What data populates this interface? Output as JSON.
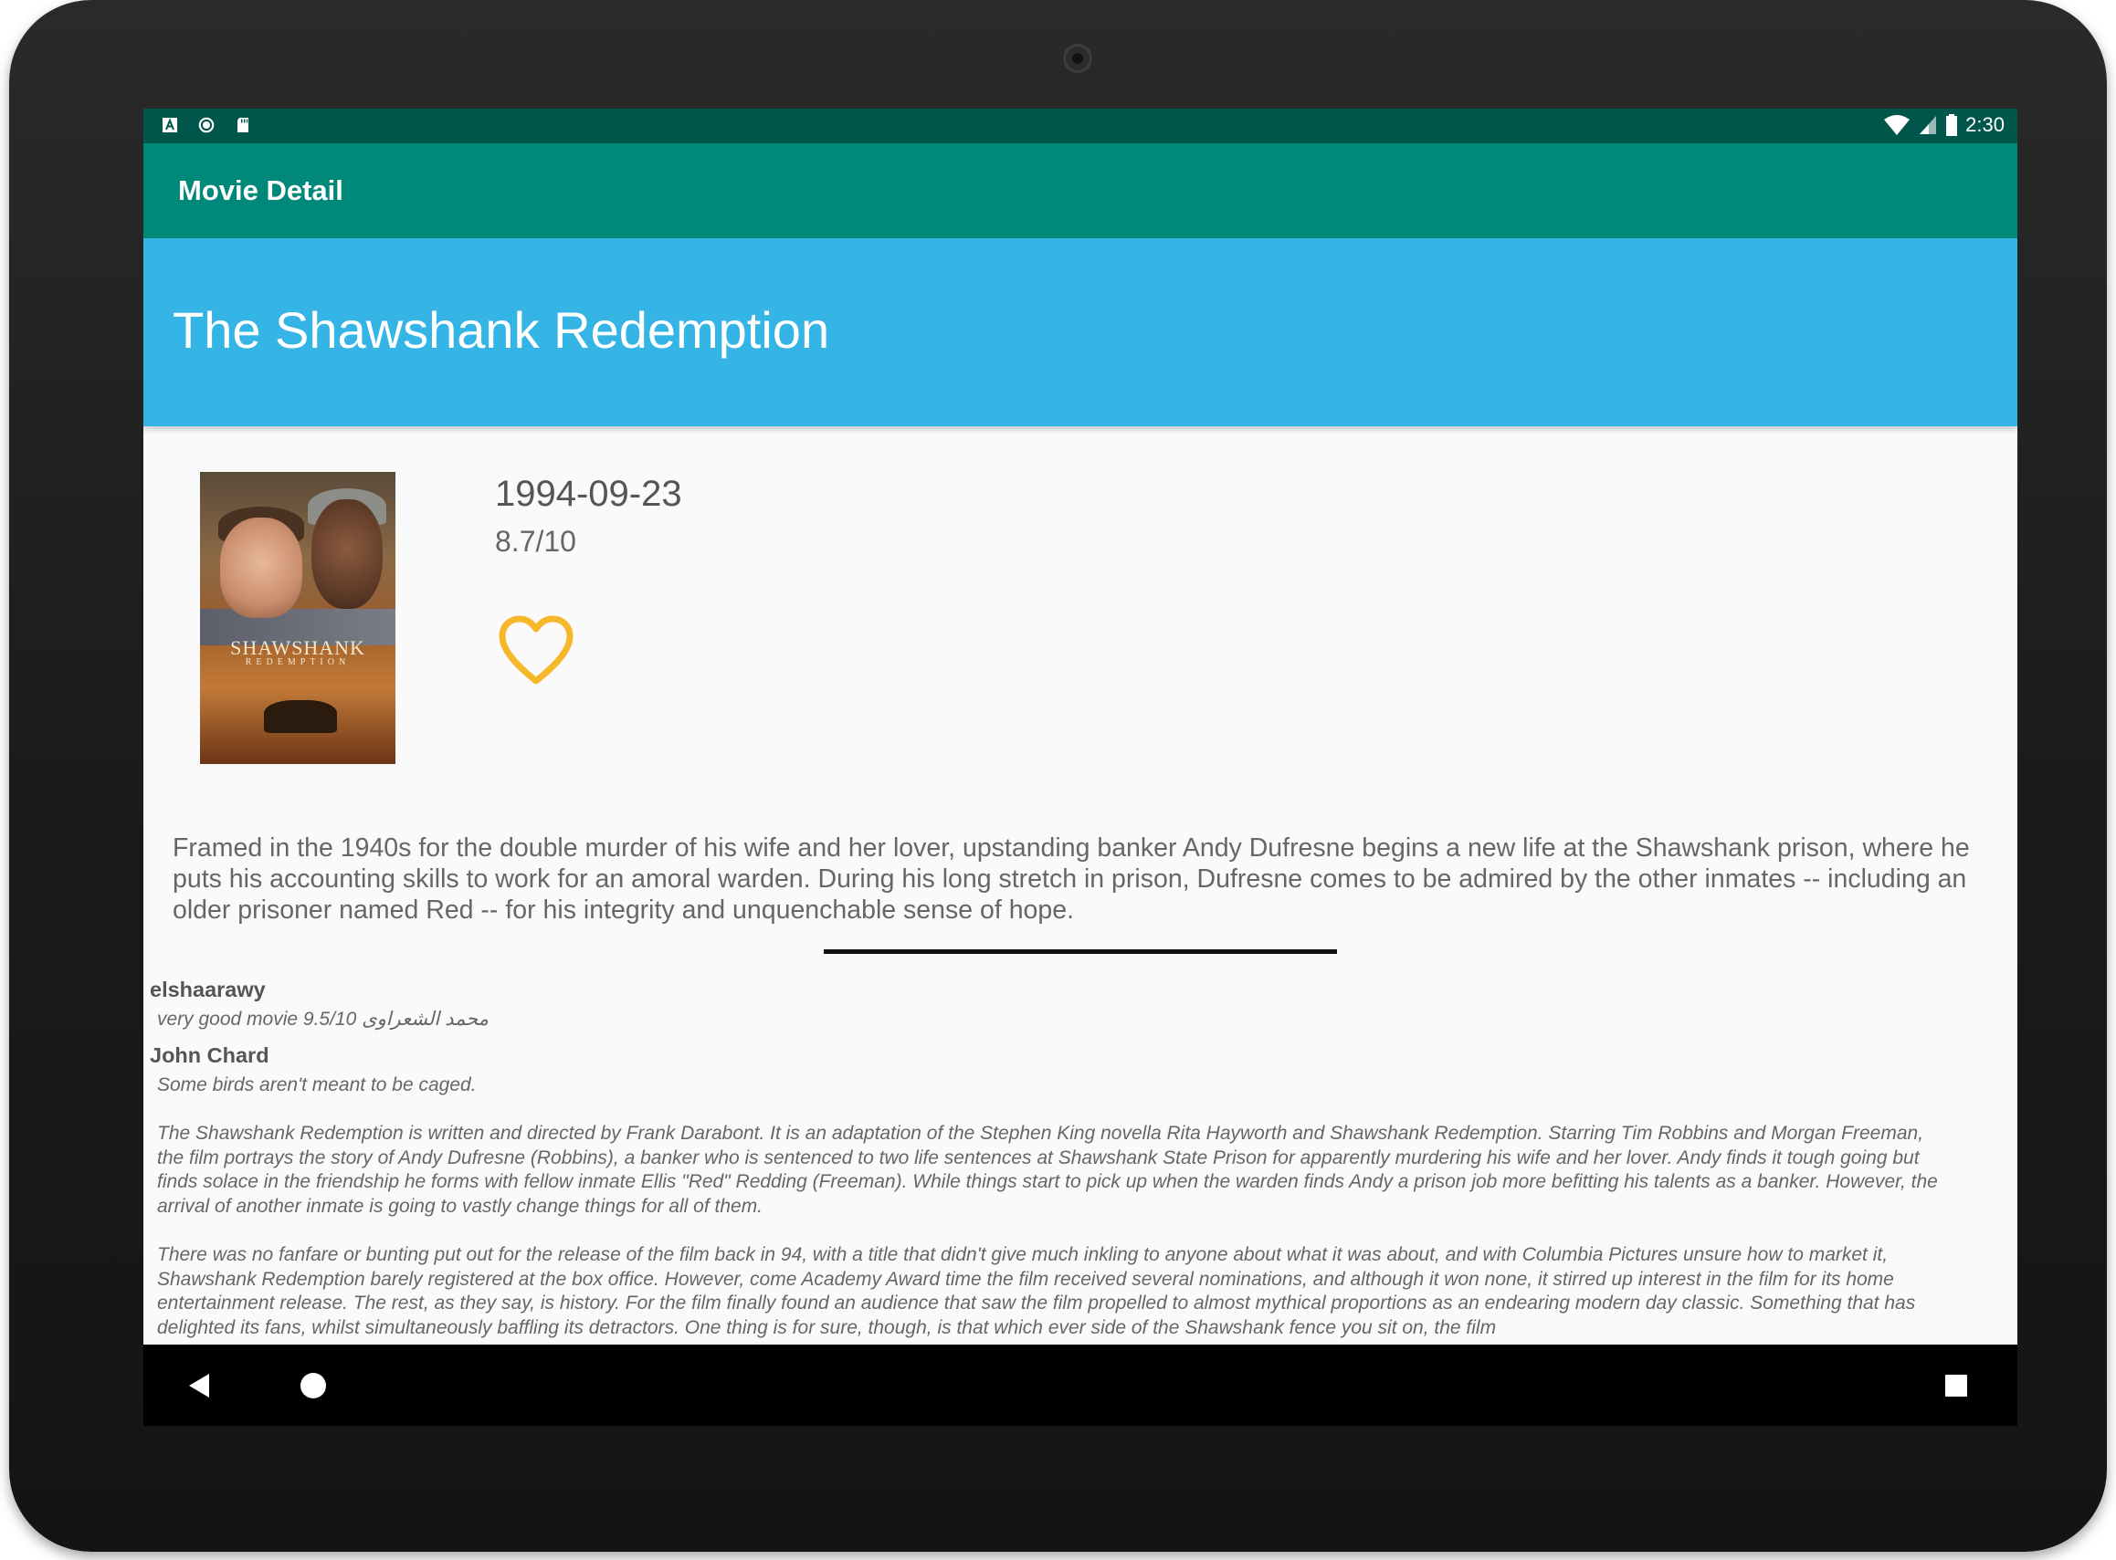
{
  "status_bar": {
    "time": "2:30",
    "left_icons": [
      "a-icon",
      "sync-icon",
      "sd-card-icon"
    ],
    "right_icons": [
      "wifi-icon",
      "signal-icon",
      "battery-icon"
    ]
  },
  "app_bar": {
    "title": "Movie Detail"
  },
  "movie": {
    "title": "The Shawshank Redemption",
    "release_date": "1994-09-23",
    "rating": "8.7/10",
    "poster_title": "SHAWSHANK",
    "poster_subtitle": "REDEMPTION",
    "favorite_icon": "heart-outline-icon",
    "favorite_color": "#f6b82a",
    "overview": "Framed in the 1940s for the double murder of his wife and her lover, upstanding banker Andy Dufresne begins a new life at the Shawshank prison, where he puts his accounting skills to work for an amoral warden. During his long stretch in prison, Dufresne comes to be admired by the other inmates -- including an older prisoner named Red -- for his integrity and unquenchable sense of hope."
  },
  "reviews": [
    {
      "author": "elshaarawy",
      "content": [
        "very good movie 9.5/10 محمد الشعراوى"
      ]
    },
    {
      "author": "John Chard",
      "content": [
        "Some birds aren't meant to be caged.",
        "The Shawshank Redemption is written and directed by Frank Darabont. It is an adaptation of the Stephen King novella Rita Hayworth and Shawshank Redemption. Starring Tim Robbins and Morgan Freeman, the film portrays the story of Andy Dufresne (Robbins), a banker who is sentenced to two life sentences at Shawshank State Prison for apparently murdering his wife and her lover. Andy finds it tough going but finds solace in the friendship he forms with fellow inmate Ellis \"Red\" Redding (Freeman). While things start to pick up when the warden finds Andy a prison job more befitting his talents as a banker. However, the arrival of another inmate is going to vastly change things for all of them.",
        "There was no fanfare or bunting put out for the release of the film back in 94, with a title that didn't give much inkling to anyone about what it was about, and with Columbia Pictures unsure how to market it, Shawshank Redemption barely registered at the box office. However, come Academy Award time the film received several nominations, and although it won none, it stirred up interest in the film for its home entertainment release. The rest, as they say, is history. For the film finally found an audience that saw the film propelled to almost mythical proportions as an endearing modern day classic. Something that has delighted its fans, whilst simultaneously baffling its detractors. One thing is for sure, though, is that which ever side of the Shawshank fence you sit on, the film"
      ]
    }
  ],
  "nav_bar": {
    "back_icon": "back-triangle-icon",
    "home_icon": "home-circle-icon",
    "recents_icon": "recents-square-icon"
  },
  "colors": {
    "status_bar": "#00564b",
    "app_bar": "#00897b",
    "title_band": "#35b5e5",
    "background": "#fafafa"
  }
}
